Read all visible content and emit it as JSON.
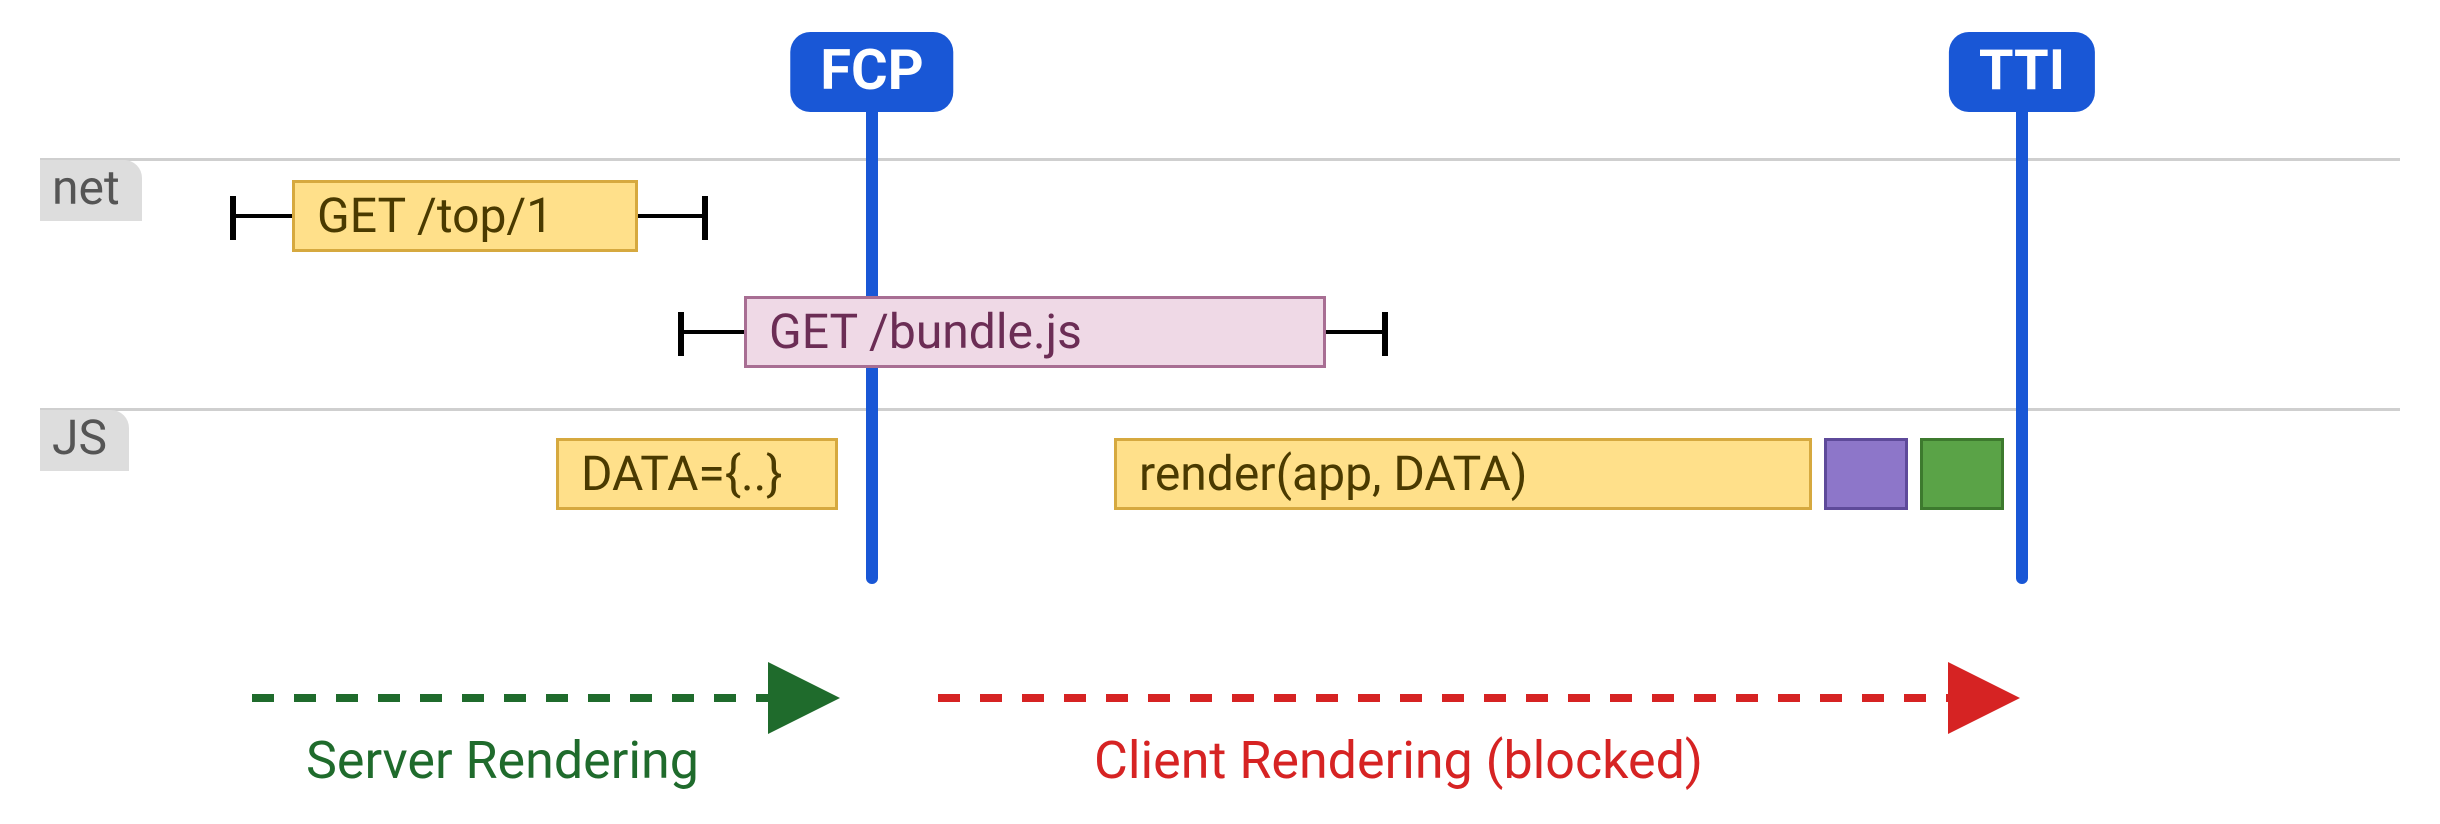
{
  "lanes": {
    "net": "net",
    "js": "JS"
  },
  "markers": {
    "fcp": {
      "label": "FCP",
      "color": "#1957d6"
    },
    "tti": {
      "label": "TTI",
      "color": "#1957d6"
    }
  },
  "net": {
    "req1": {
      "label": "GET /top/1"
    },
    "req2": {
      "label": "GET /bundle.js"
    }
  },
  "js": {
    "data": {
      "label": "DATA={..}"
    },
    "render": {
      "label": "render(app, DATA)"
    }
  },
  "phases": {
    "server": {
      "label": "Server Rendering",
      "color": "#1f6b2c"
    },
    "client": {
      "label": "Client Rendering (blocked)",
      "color": "#d62323"
    }
  }
}
